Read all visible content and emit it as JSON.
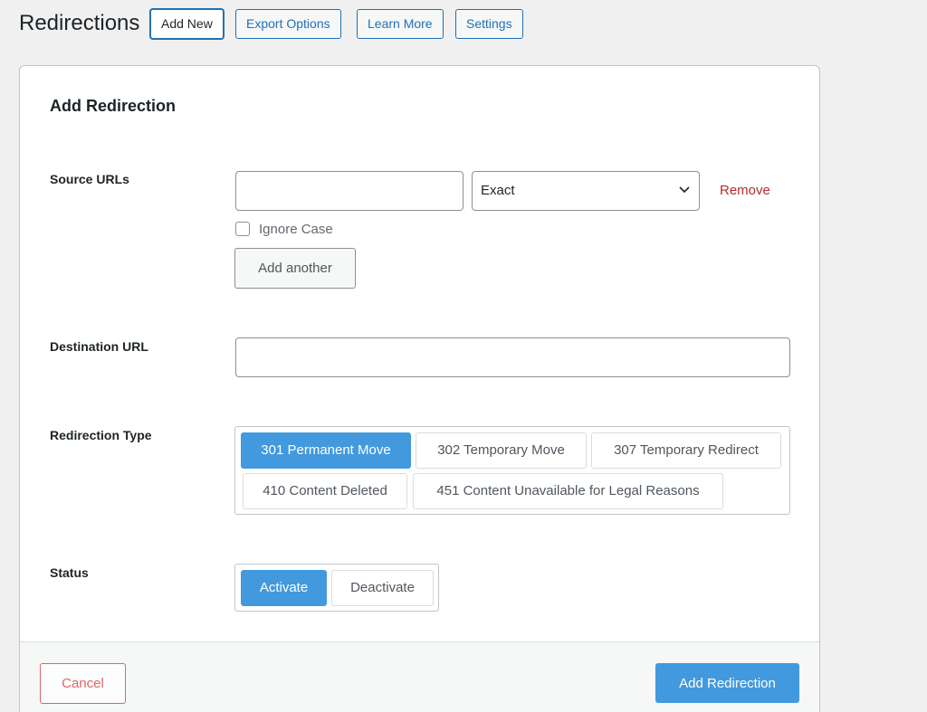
{
  "header": {
    "title": "Redirections",
    "buttons": {
      "add_new": "Add New",
      "export_options": "Export Options",
      "learn_more": "Learn More",
      "settings": "Settings"
    }
  },
  "form": {
    "title": "Add Redirection",
    "source_urls": {
      "label": "Source URLs",
      "value": "",
      "match_type": "Exact",
      "remove_label": "Remove",
      "ignore_case_label": "Ignore Case",
      "ignore_case_checked": false,
      "add_another_label": "Add another"
    },
    "destination": {
      "label": "Destination URL",
      "value": ""
    },
    "redirection_type": {
      "label": "Redirection Type",
      "options": [
        "301 Permanent Move",
        "302 Temporary Move",
        "307 Temporary Redirect",
        "410 Content Deleted",
        "451 Content Unavailable for Legal Reasons"
      ],
      "selected": "301 Permanent Move"
    },
    "status": {
      "label": "Status",
      "options": [
        "Activate",
        "Deactivate"
      ],
      "selected": "Activate"
    },
    "footer": {
      "cancel_label": "Cancel",
      "submit_label": "Add Redirection"
    }
  },
  "colors": {
    "accent": "#4299dd",
    "link": "#2271b1",
    "danger": "#d63638"
  }
}
